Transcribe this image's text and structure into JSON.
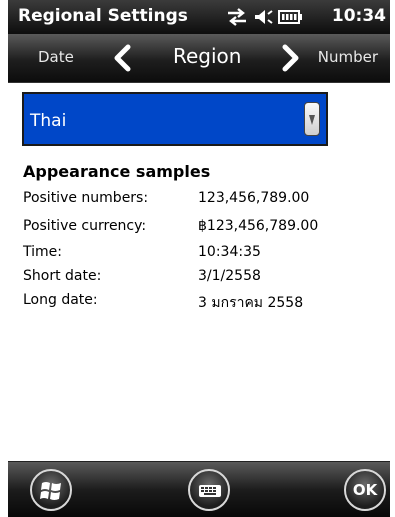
{
  "status_bar": {
    "title": "Regional Settings",
    "time": "10:34",
    "icons": [
      "data-connection-icon",
      "speaker-icon",
      "battery-icon"
    ]
  },
  "tabs": {
    "previous": "Date",
    "current": "Region",
    "next": "Number"
  },
  "region_select": {
    "value": "Thai"
  },
  "samples": {
    "heading": "Appearance samples",
    "rows": [
      {
        "label": "Positive numbers:",
        "value": "123,456,789.00"
      },
      {
        "label": "Positive currency:",
        "value": "฿123,456,789.00"
      },
      {
        "label": "Time:",
        "value": "10:34:35"
      },
      {
        "label": "Short date:",
        "value": "3/1/2558"
      },
      {
        "label": "Long date:",
        "value": "3 มกราคม 2558"
      }
    ]
  },
  "softkeys": {
    "ok_label": "OK",
    "icons": [
      "windows-start-icon",
      "keyboard-icon"
    ]
  },
  "colors": {
    "selection": "#0047c8",
    "bar_dark": "#0d0d0d"
  }
}
